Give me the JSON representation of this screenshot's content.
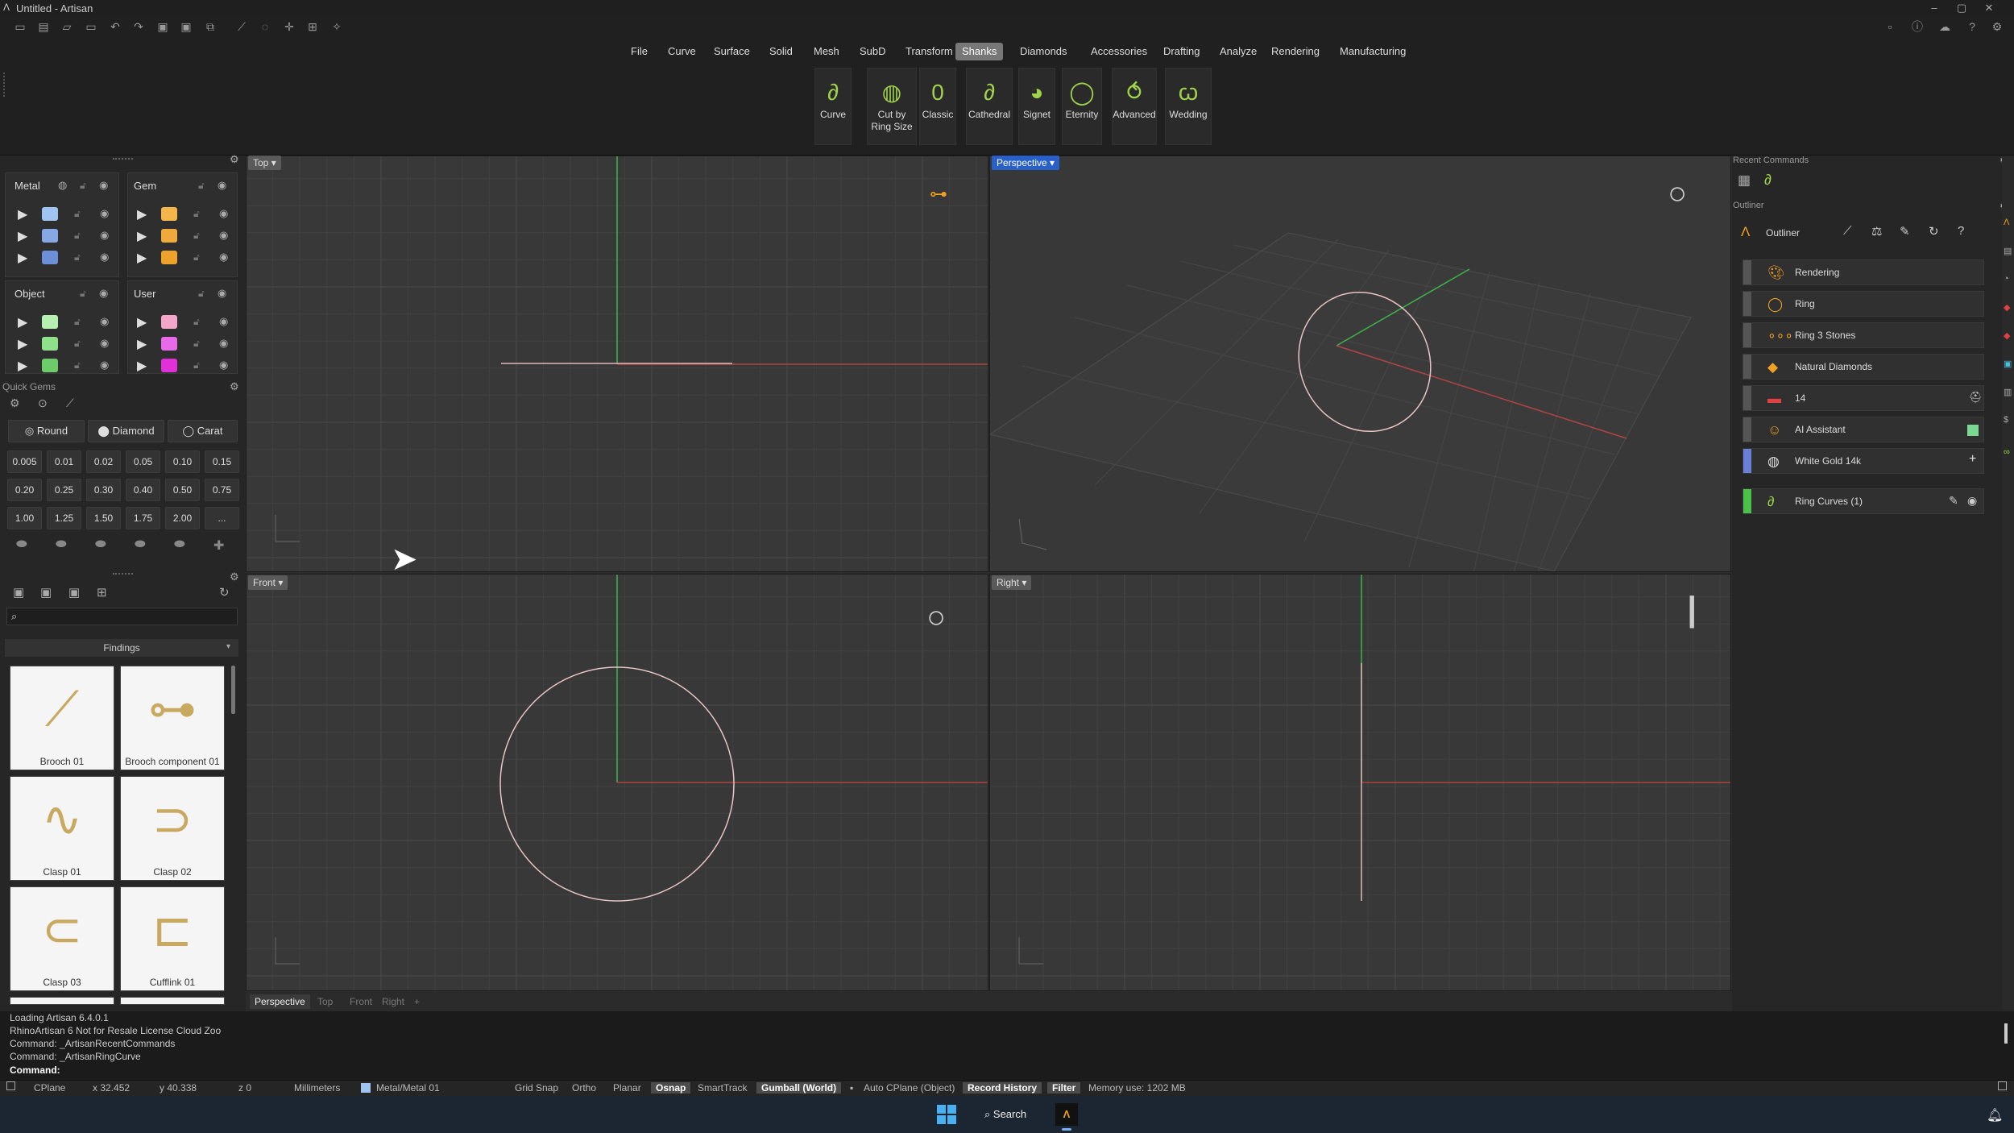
{
  "window": {
    "title": "Untitled - Artisan"
  },
  "menu": {
    "tabs": [
      "File",
      "Curve",
      "Surface",
      "Solid",
      "Mesh",
      "SubD",
      "Transform",
      "Shanks",
      "Diamonds",
      "Accessories",
      "Drafting",
      "Analyze",
      "Rendering",
      "Manufacturing"
    ],
    "active": "Shanks"
  },
  "ribbon": {
    "buttons": [
      {
        "label": "Curve",
        "icon": "ring-curve-icon"
      },
      {
        "label": "Cut by Ring Size",
        "icon": "cut-ring-icon"
      },
      {
        "label": "Classic",
        "icon": "classic-ring-icon"
      },
      {
        "label": "Cathedral",
        "icon": "cathedral-ring-icon"
      },
      {
        "label": "Signet",
        "icon": "signet-ring-icon"
      },
      {
        "label": "Eternity",
        "icon": "eternity-ring-icon"
      },
      {
        "label": "Advanced",
        "icon": "advanced-ring-icon"
      },
      {
        "label": "Wedding",
        "icon": "wedding-ring-icon"
      }
    ]
  },
  "layers": {
    "metal": {
      "title": "Metal",
      "colors": [
        "#9fc4f0",
        "#86a9e6",
        "#6c8fd8"
      ]
    },
    "gem": {
      "title": "Gem",
      "colors": [
        "#f4b64a",
        "#f0aa3c",
        "#eea22c"
      ]
    },
    "object": {
      "title": "Object",
      "colors": [
        "#b6f0b0",
        "#8fe08a",
        "#6ccc6a"
      ]
    },
    "user": {
      "title": "User",
      "colors": [
        "#f4a6c8",
        "#e86ae8",
        "#e030d8"
      ]
    }
  },
  "quick_gems": {
    "title": "Quick Gems",
    "shape": "Round",
    "cut": "Diamond",
    "unit": "Carat",
    "sizes": [
      "0.005",
      "0.01",
      "0.02",
      "0.05",
      "0.10",
      "0.15",
      "0.20",
      "0.25",
      "0.30",
      "0.40",
      "0.50",
      "0.75",
      "1.00",
      "1.25",
      "1.50",
      "1.75",
      "2.00",
      "..."
    ]
  },
  "library": {
    "category": "Findings",
    "items": [
      "Brooch 01",
      "Brooch component 01",
      "Clasp 01",
      "Clasp 02",
      "Clasp 03",
      "Cufflink 01"
    ]
  },
  "viewports": {
    "top": "Top",
    "perspective": "Perspective",
    "front": "Front",
    "right": "Right"
  },
  "viewport_tabs": [
    "Perspective",
    "Top",
    "Front",
    "Right",
    "+"
  ],
  "recent_commands": {
    "title": "Recent Commands"
  },
  "outliner": {
    "title": "Outliner",
    "header": "Outliner",
    "items": [
      {
        "label": "Rendering",
        "icon": "palette-icon",
        "bar": "#555"
      },
      {
        "label": "Ring",
        "icon": "ring-icon",
        "bar": "#555"
      },
      {
        "label": "Ring 3 Stones",
        "icon": "stones-icon",
        "bar": "#555"
      },
      {
        "label": "Natural Diamonds",
        "icon": "diamond-icon",
        "bar": "#555"
      },
      {
        "label": "14",
        "icon": "flag-icon",
        "bar": "#555"
      },
      {
        "label": "AI Assistant",
        "icon": "ai-icon",
        "bar": "#555"
      },
      {
        "label": "White Gold 14k",
        "icon": "metal-icon",
        "bar": "#6a7fd8"
      }
    ],
    "group": {
      "label": "Ring Curves (1)",
      "bar": "#4ac24a"
    }
  },
  "command_history": [
    "Loading Artisan 6.4.0.1",
    "RhinoArtisan 6 Not for Resale License Cloud Zoo",
    "Command: _ArtisanRecentCommands",
    "Command: _ArtisanRingCurve"
  ],
  "command_prompt": "Command:",
  "status": {
    "cplane": "CPlane",
    "x": "x 32.452",
    "y": "y 40.338",
    "z": "z 0",
    "units": "Millimeters",
    "layer": "Metal/Metal 01",
    "grid_snap": "Grid Snap",
    "ortho": "Ortho",
    "planar": "Planar",
    "osnap": "Osnap",
    "smarttrack": "SmartTrack",
    "gumball": "Gumball (World)",
    "auto_cplane": "Auto CPlane (Object)",
    "record_history": "Record History",
    "filter": "Filter",
    "memory": "Memory use: 1202 MB"
  },
  "taskbar": {
    "search": "Search"
  }
}
